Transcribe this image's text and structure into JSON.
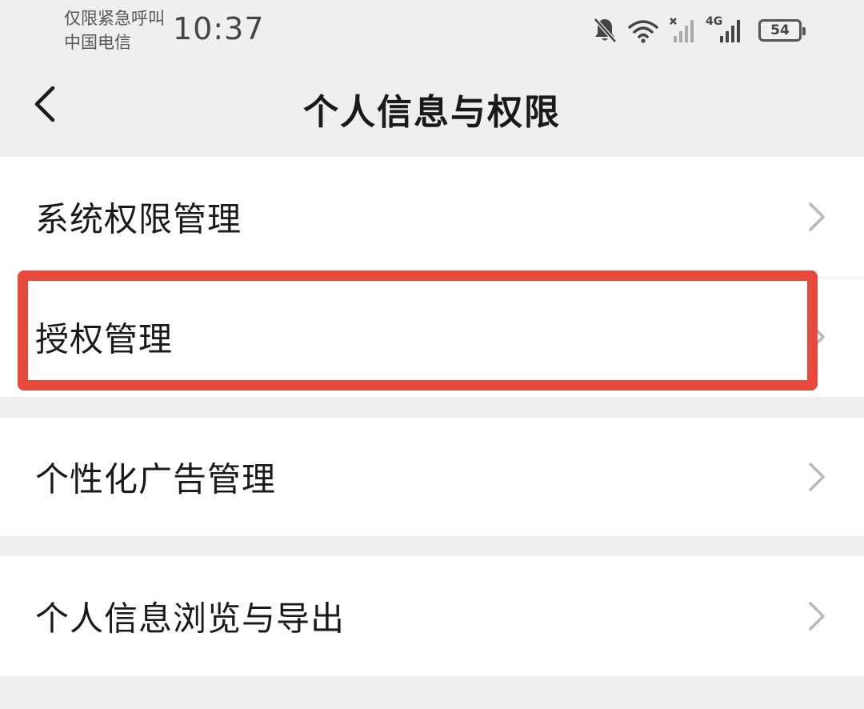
{
  "status_bar": {
    "carrier_line1": "仅限紧急呼叫",
    "carrier_line2": "中国电信",
    "time": "10:37",
    "network_type": "4G",
    "battery_level": "54",
    "icons": [
      "mute-bell-icon",
      "wifi-icon",
      "no-signal-icon",
      "cellular-signal-icon",
      "battery-icon"
    ]
  },
  "header": {
    "title": "个人信息与权限",
    "back_icon": "chevron-left-icon"
  },
  "menu": {
    "items": [
      {
        "label": "系统权限管理"
      },
      {
        "label": "授权管理"
      },
      {
        "label": "个性化广告管理"
      },
      {
        "label": "个人信息浏览与导出"
      }
    ],
    "chevron_icon": "chevron-right-icon"
  },
  "annotation": {
    "color": "#e8493d"
  }
}
